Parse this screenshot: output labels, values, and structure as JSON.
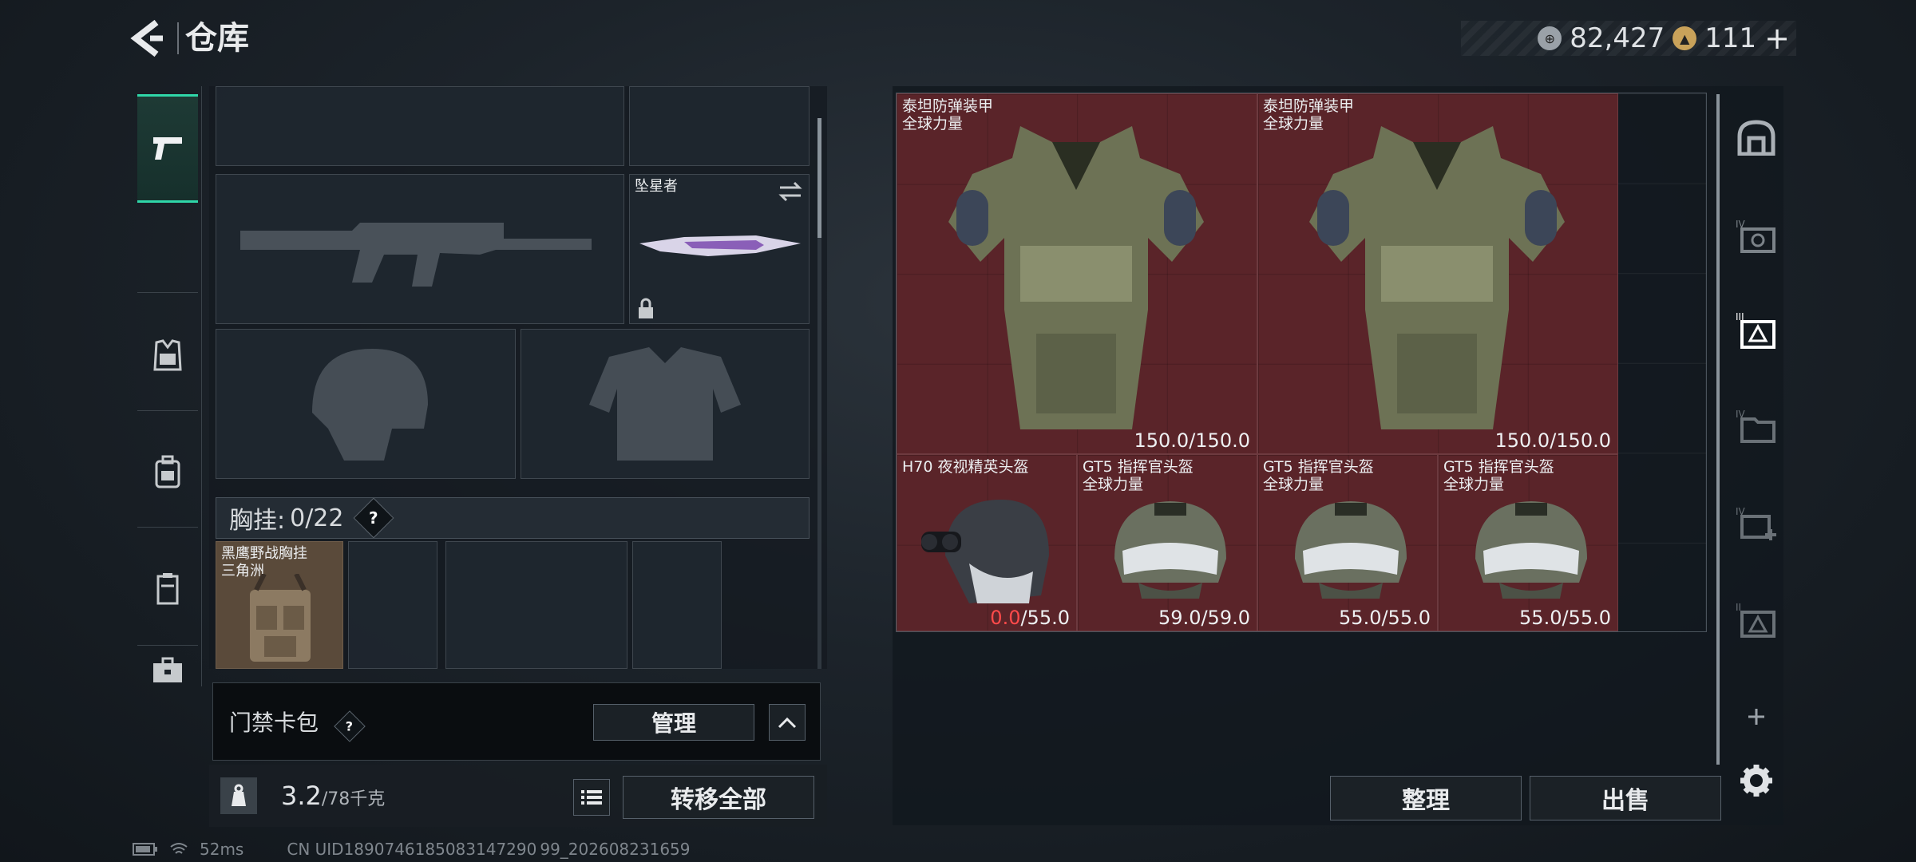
{
  "header": {
    "title": "仓库"
  },
  "currency": {
    "silver": "82,427",
    "gold": "111"
  },
  "sidebar": {
    "items": [
      {
        "name": "weapons",
        "icon": "pistol-icon",
        "active": true
      },
      {
        "name": "vest",
        "icon": "vest-icon",
        "active": false
      },
      {
        "name": "backpack",
        "icon": "backpack-icon",
        "active": false
      },
      {
        "name": "container",
        "icon": "container-icon",
        "active": false
      },
      {
        "name": "case",
        "icon": "briefcase-icon",
        "active": false
      }
    ]
  },
  "equipment": {
    "melee": {
      "name": "坠星者",
      "locked": true
    },
    "chest_rig": {
      "label": "胸挂:",
      "count": "0/22"
    },
    "rig_item": {
      "name": "黑鹰野战胸挂\n三角洲"
    }
  },
  "keycase": {
    "label": "门禁卡包",
    "manage_label": "管理"
  },
  "inventory": {
    "weight": "3.2",
    "weight_max": "/78千克",
    "transfer_label": "转移全部"
  },
  "stash": {
    "items": [
      {
        "name": "泰坦防弹装甲\n全球力量",
        "dur_cur": "150.0",
        "dur_max": "/150.0",
        "low": false,
        "type": "armor"
      },
      {
        "name": "泰坦防弹装甲\n全球力量",
        "dur_cur": "150.0",
        "dur_max": "/150.0",
        "low": false,
        "type": "armor"
      },
      {
        "name": "H70 夜视精英头盔",
        "dur_cur": "0.0",
        "dur_max": "/55.0",
        "low": true,
        "type": "nvg-helmet"
      },
      {
        "name": "GT5 指挥官头盔\n全球力量",
        "dur_cur": "59.0",
        "dur_max": "/59.0",
        "low": false,
        "type": "helmet"
      },
      {
        "name": "GT5 指挥官头盔\n全球力量",
        "dur_cur": "55.0",
        "dur_max": "/55.0",
        "low": false,
        "type": "helmet"
      },
      {
        "name": "GT5 指挥官头盔\n全球力量",
        "dur_cur": "55.0",
        "dur_max": "/55.0",
        "low": false,
        "type": "helmet"
      }
    ],
    "sort_label": "整理",
    "sell_label": "出售"
  },
  "status": {
    "ping": "52ms",
    "uid": "CN UID1890746185083147290 99_202608231659"
  },
  "colors": {
    "accent": "#2fd6a8",
    "item_bg": "#5a2429",
    "low_durability": "#ff4a4a"
  }
}
